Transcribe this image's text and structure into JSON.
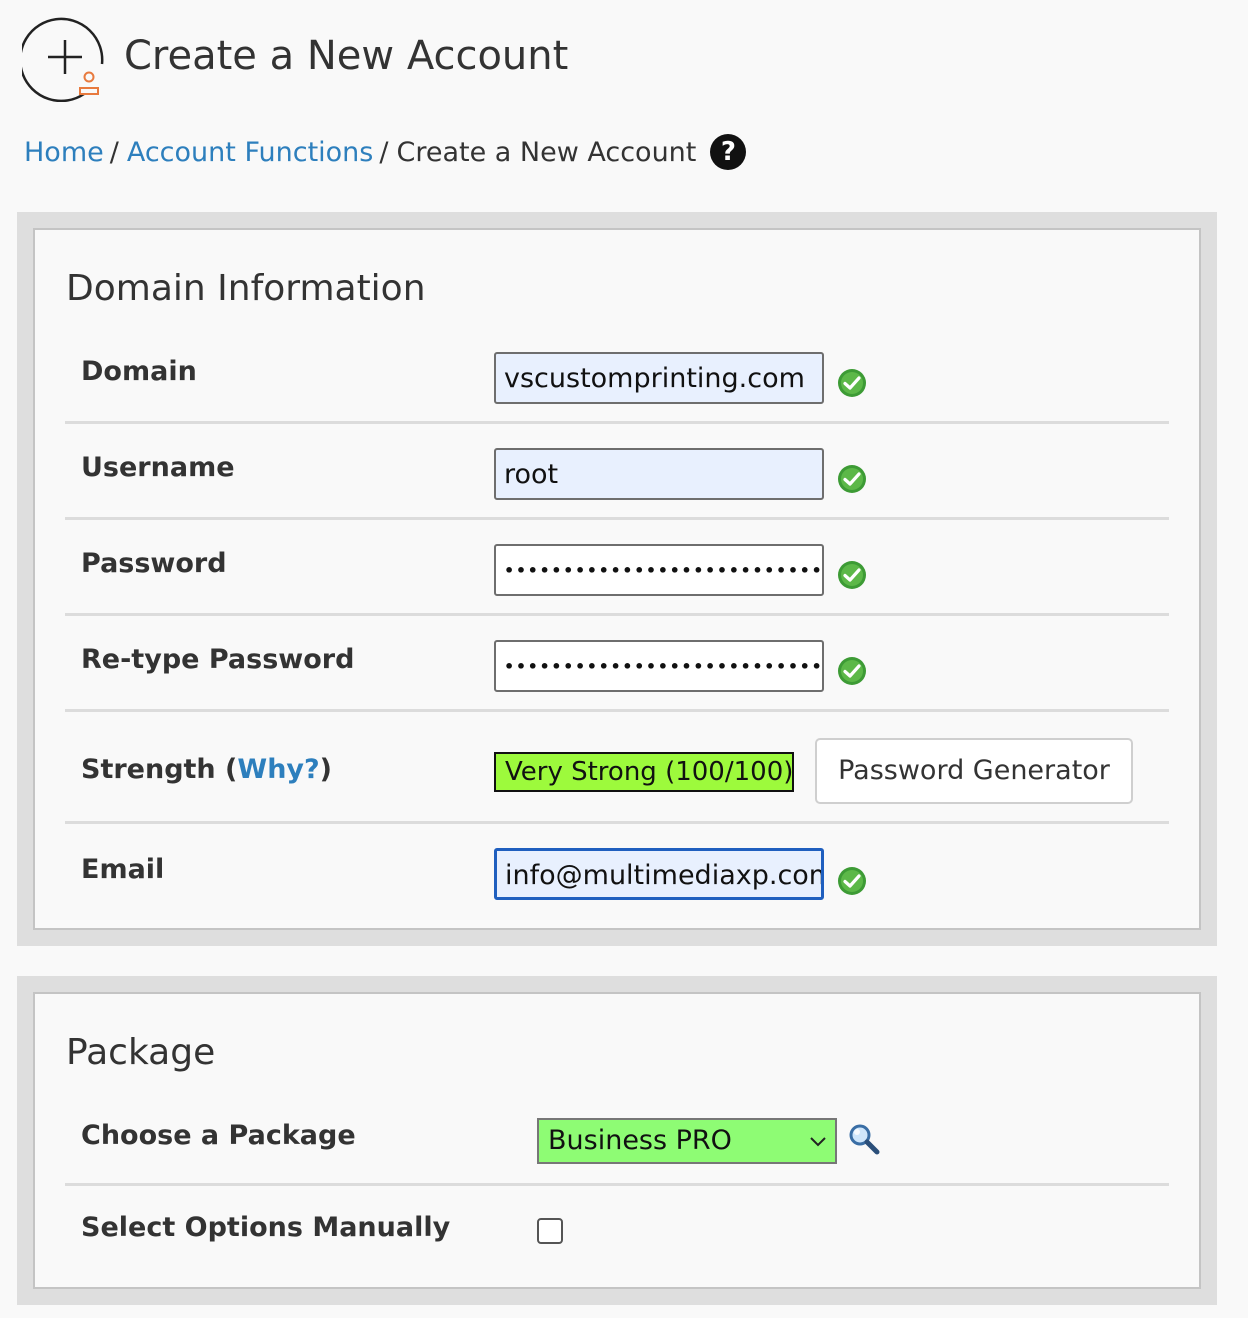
{
  "header": {
    "title": "Create a New Account",
    "icon": "add-account-icon"
  },
  "breadcrumb": {
    "items": [
      "Home",
      "Account Functions"
    ],
    "separator": "/",
    "current": "Create a New Account",
    "help_icon": "question-circle-icon"
  },
  "domain_info": {
    "title": "Domain Information",
    "domain": {
      "label": "Domain",
      "value": "vscustomprinting.com"
    },
    "username": {
      "label": "Username",
      "value": "root"
    },
    "password": {
      "label": "Password",
      "value": "••••••••••••••••••••••••••••••"
    },
    "retype": {
      "label": "Re-type Password",
      "value": "••••••••••••••••••••••••••••••"
    },
    "strength": {
      "label_prefix": "Strength (",
      "why": "Why?",
      "label_suffix": ")",
      "value": "Very Strong (100/100)",
      "color": "#9dfa3c"
    },
    "password_generator": "Password Generator",
    "email": {
      "label": "Email",
      "value": "info@multimediaxp.com"
    },
    "valid_icon": "green-check-icon"
  },
  "package": {
    "title": "Package",
    "choose_label": "Choose a Package",
    "selected": "Business PRO",
    "select_color": "#8efc74",
    "search_icon": "magnifier-icon",
    "manual_label": "Select Options Manually",
    "manual_checked": false
  },
  "colors": {
    "link": "#2d7fbd",
    "accent": "#e87a3e"
  }
}
